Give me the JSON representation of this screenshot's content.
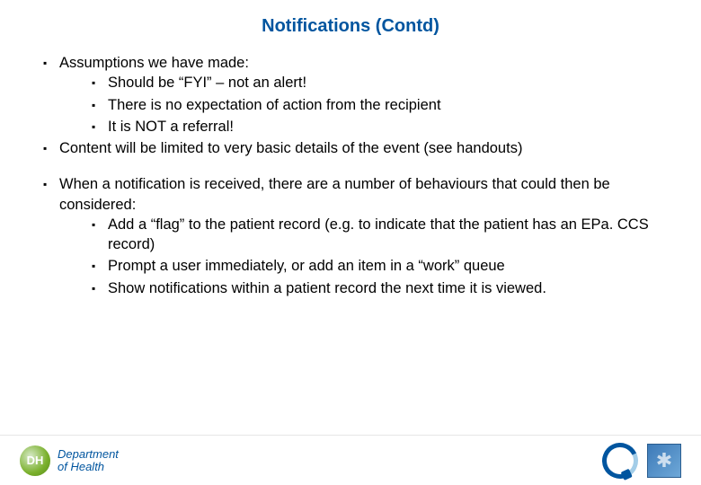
{
  "title": "Notifications (Contd)",
  "block1": {
    "items": [
      {
        "text": "Assumptions we have made:",
        "sub": [
          "Should be “FYI” – not an alert!",
          "There is no expectation of action from the recipient",
          "It is NOT a referral!"
        ]
      },
      {
        "text": "Content will be limited to very basic details of the event (see handouts)"
      }
    ]
  },
  "block2": {
    "items": [
      {
        "text": "When a notification is received, there are a number of behaviours that could then be considered:",
        "sub": [
          "Add a “flag” to the patient record (e.g. to indicate that the patient has an EPa. CCS record)",
          "Prompt a user immediately, or add an item in a “work” queue",
          "Show notifications within a patient record the next time it is viewed."
        ]
      }
    ]
  },
  "footer": {
    "dh_badge": "DH",
    "dh_line1": "Department",
    "dh_line2": "of Health"
  }
}
